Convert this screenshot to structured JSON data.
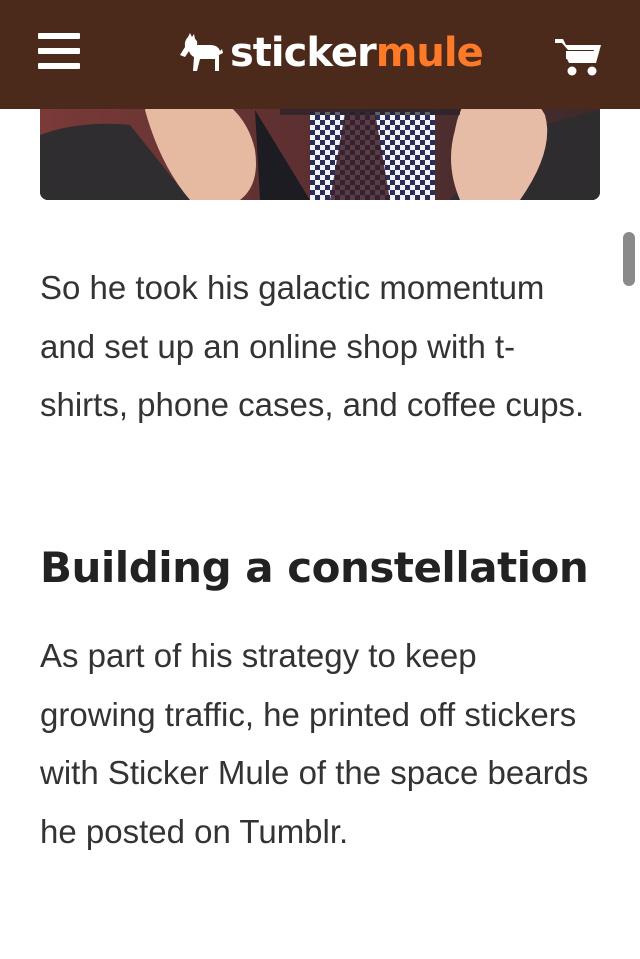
{
  "header": {
    "brand_part1": "sticker",
    "brand_part2": "mule",
    "colors": {
      "background": "#4b2a1c",
      "brand_accent": "#ff7a28"
    },
    "icons": [
      "menu-icon",
      "mule-logo-icon",
      "cart-icon"
    ]
  },
  "article": {
    "paragraph_1": "So he took his galactic momentum and set up an online shop with t-shirts, phone cases, and coffee cups.",
    "heading": "Building a constellation",
    "paragraph_2": "As part of his strategy to keep growing traffic, he printed off stickers with Sticker Mule of the space beards he posted on Tumblr."
  }
}
